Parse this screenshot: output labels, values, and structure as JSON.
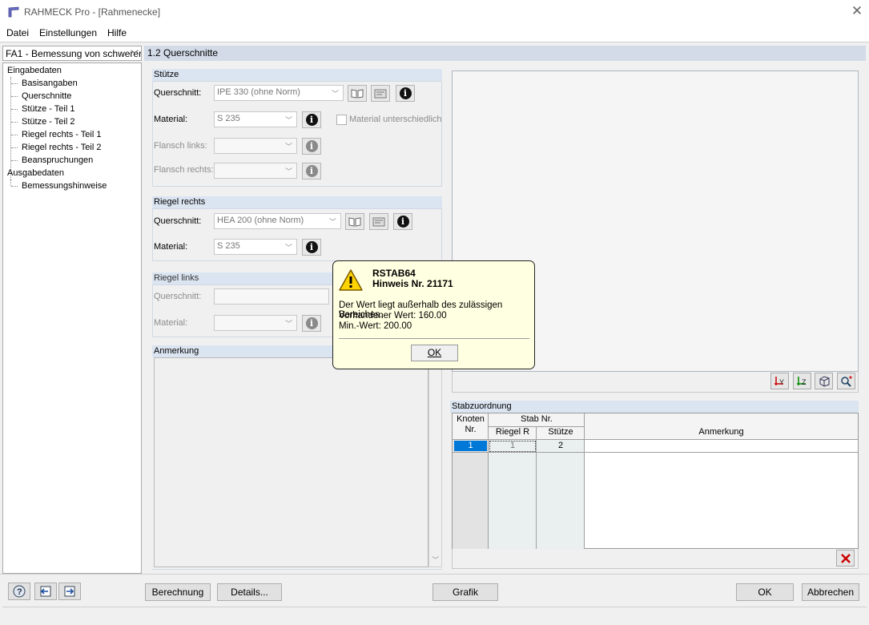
{
  "window": {
    "title": "RAHMECK Pro - [Rahmenecke]"
  },
  "menu": [
    "Datei",
    "Einstellungen",
    "Hilfe"
  ],
  "case_select": "FA1 - Bemessung von schwerer",
  "nav": {
    "input_root": "Eingabedaten",
    "input_items": [
      "Basisangaben",
      "Querschnitte",
      "Stütze - Teil 1",
      "Stütze - Teil 2",
      "Riegel rechts - Teil 1",
      "Riegel rechts - Teil 2",
      "Beanspruchungen"
    ],
    "output_root": "Ausgabedaten",
    "output_items": [
      "Bemessungshinweise"
    ]
  },
  "header": {
    "title": "1.2 Querschnitte"
  },
  "stuetze": {
    "title": "Stütze",
    "querschnitt_label": "Querschnitt:",
    "querschnitt_value": "IPE 330 (ohne Norm)",
    "material_label": "Material:",
    "material_value": "S 235",
    "material_diff_label": "Material unterschiedlich",
    "flansch_links_label": "Flansch links:",
    "flansch_rechts_label": "Flansch rechts:"
  },
  "riegel_rechts": {
    "title": "Riegel rechts",
    "querschnitt_label": "Querschnitt:",
    "querschnitt_value": "HEA 200 (ohne Norm)",
    "material_label": "Material:",
    "material_value": "S 235"
  },
  "riegel_links": {
    "title": "Riegel links",
    "querschnitt_label": "Querschnitt:",
    "material_label": "Material:"
  },
  "anmerkung": {
    "title": "Anmerkung"
  },
  "stabzuordnung": {
    "title": "Stabzuordnung",
    "col_knoten_1": "Knoten",
    "col_knoten_2": "Nr.",
    "col_stab": "Stab Nr.",
    "col_riegel": "Riegel R",
    "col_stuetze": "Stütze",
    "col_anmerkung": "Anmerkung",
    "rows": [
      {
        "knoten": "1",
        "riegel": "1",
        "stuetze": "2"
      }
    ]
  },
  "graphic_toolbar": [
    "Y",
    "Z",
    "3D",
    "zoom"
  ],
  "buttons": {
    "berechnung": "Berechnung",
    "details": "Details...",
    "grafik": "Grafik",
    "ok": "OK",
    "abbrechen": "Abbrechen"
  },
  "dialog": {
    "title": "RSTAB64",
    "subtitle": "Hinweis Nr. 21171",
    "line1": "Der Wert liegt außerhalb des zulässigen Bereiches.",
    "line2": "Vorhandener Wert: 160.00",
    "line3": "Min.-Wert: 200.00",
    "ok": "OK"
  },
  "colors": {
    "group_header": "#dbe5f1",
    "main_header": "#d2dbe7",
    "selection": "#0078d7",
    "dialog_bg": "#ffffe1"
  }
}
